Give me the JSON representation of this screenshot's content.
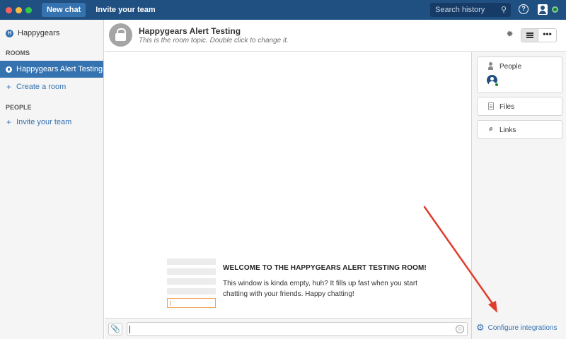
{
  "topbar": {
    "new_chat_label": "New chat",
    "invite_label": "Invite your team",
    "search_placeholder": "Search history"
  },
  "sidebar": {
    "team_initial": "H",
    "team_name": "Happygears",
    "rooms_title": "ROOMS",
    "rooms": [
      {
        "label": "Happygears Alert Testing",
        "active": true
      }
    ],
    "create_room_label": "Create a room",
    "people_title": "PEOPLE",
    "invite_team_label": "Invite your team"
  },
  "room": {
    "title": "Happygears Alert Testing",
    "topic": "This is the room topic. Double click to change it.",
    "more_label": "•••"
  },
  "chat": {
    "welcome_title": "WELCOME TO THE HAPPYGEARS ALERT TESTING ROOM!",
    "welcome_text": "This window is kinda empty, huh? It fills up fast when you start chatting with your friends. Happy chatting!"
  },
  "right_panel": {
    "people_label": "People",
    "files_label": "Files",
    "links_label": "Links",
    "configure_label": "Configure integrations"
  },
  "colors": {
    "topbar": "#205081",
    "accent": "#3572b0",
    "online": "#14892c",
    "annotation_arrow": "#e03c2c"
  },
  "icons": [
    "search-icon",
    "help-icon",
    "user-icon",
    "lock-icon",
    "bug-icon",
    "list-view-icon",
    "more-icon",
    "paperclip-icon",
    "smiley-icon",
    "person-icon",
    "file-icon",
    "link-icon",
    "gear-icon"
  ]
}
